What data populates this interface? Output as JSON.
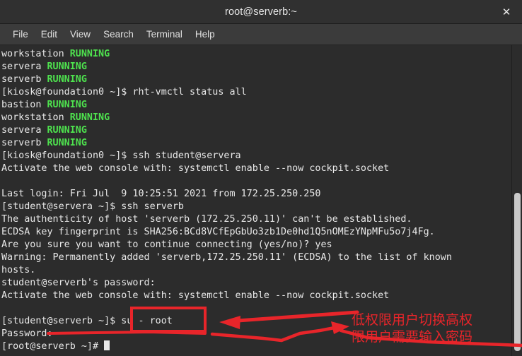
{
  "window": {
    "title": "root@serverb:~",
    "close_label": "✕"
  },
  "menubar": {
    "items": [
      {
        "label": "File"
      },
      {
        "label": "Edit"
      },
      {
        "label": "View"
      },
      {
        "label": "Search"
      },
      {
        "label": "Terminal"
      },
      {
        "label": "Help"
      }
    ]
  },
  "terminal": {
    "lines": [
      {
        "text": "workstation ",
        "status": "RUNNING"
      },
      {
        "text": "servera ",
        "status": "RUNNING"
      },
      {
        "text": "serverb ",
        "status": "RUNNING"
      },
      {
        "text": "[kiosk@foundation0 ~]$ rht-vmctl status all",
        "status": ""
      },
      {
        "text": "bastion ",
        "status": "RUNNING"
      },
      {
        "text": "workstation ",
        "status": "RUNNING"
      },
      {
        "text": "servera ",
        "status": "RUNNING"
      },
      {
        "text": "serverb ",
        "status": "RUNNING"
      },
      {
        "text": "[kiosk@foundation0 ~]$ ssh student@servera",
        "status": ""
      },
      {
        "text": "Activate the web console with: systemctl enable --now cockpit.socket",
        "status": ""
      },
      {
        "text": "",
        "status": ""
      },
      {
        "text": "Last login: Fri Jul  9 10:25:51 2021 from 172.25.250.250",
        "status": ""
      },
      {
        "text": "[student@servera ~]$ ssh serverb",
        "status": ""
      },
      {
        "text": "The authenticity of host 'serverb (172.25.250.11)' can't be established.",
        "status": ""
      },
      {
        "text": "ECDSA key fingerprint is SHA256:BCd8VCfEpGbUo3zb1De0hd1Q5nOMEzYNpMFu5o7j4Fg.",
        "status": ""
      },
      {
        "text": "Are you sure you want to continue connecting (yes/no)? yes",
        "status": ""
      },
      {
        "text": "Warning: Permanently added 'serverb,172.25.250.11' (ECDSA) to the list of known",
        "status": ""
      },
      {
        "text": "hosts.",
        "status": ""
      },
      {
        "text": "student@serverb's password:",
        "status": ""
      },
      {
        "text": "Activate the web console with: systemctl enable --now cockpit.socket",
        "status": ""
      },
      {
        "text": "",
        "status": ""
      },
      {
        "text": "[student@serverb ~]$ su - root",
        "status": ""
      },
      {
        "text": "Password:",
        "status": ""
      },
      {
        "text": "[root@serverb ~]# ",
        "status": ""
      }
    ],
    "highlighted_command": "su - root",
    "final_prompt": "[root@serverb ~]#"
  },
  "annotations": {
    "color": "#e8252a",
    "note_line1": "低权限用户切换高权",
    "note_line2": "限用户需要输入密码"
  },
  "colors": {
    "terminal_bg": "#2c2c2c",
    "terminal_fg": "#e8e8e8",
    "status_green": "#4ee24e",
    "titlebar_bg": "#303030",
    "menubar_bg": "#3b3b3b",
    "annotation_red": "#e8252a"
  }
}
